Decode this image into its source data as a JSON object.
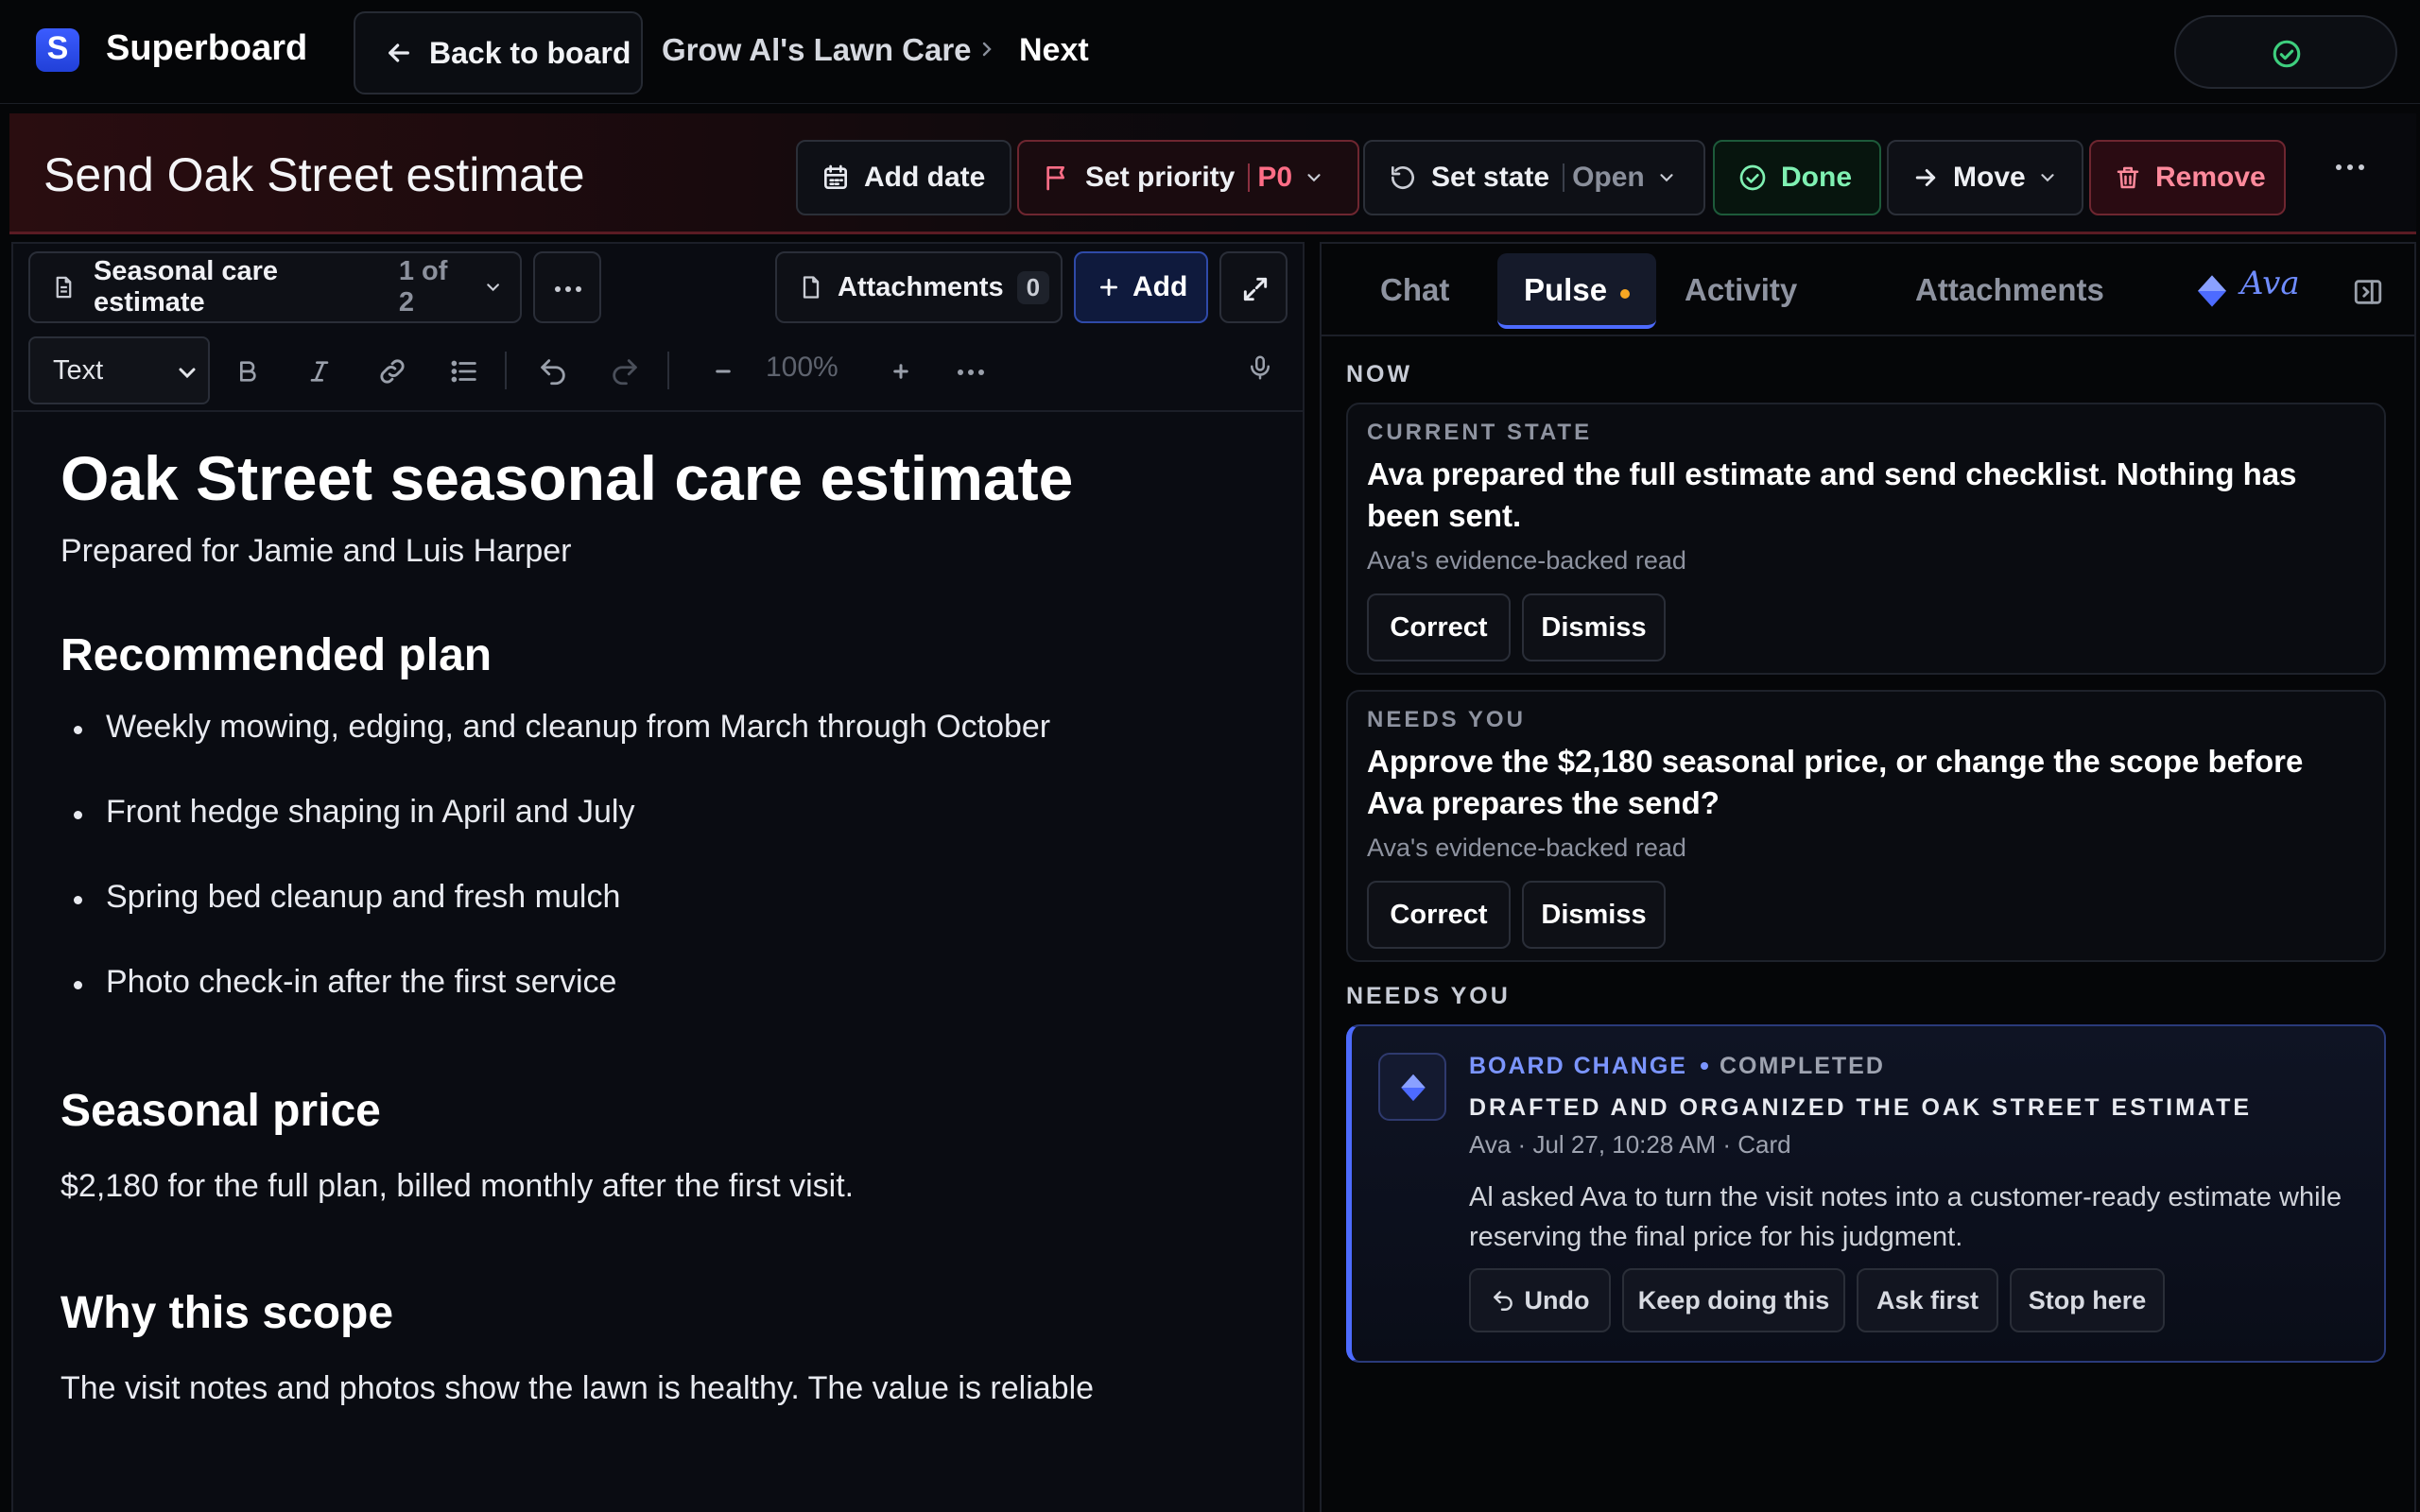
{
  "app": {
    "brand": "Superboard",
    "logo_letter": "S"
  },
  "nav": {
    "back_label": "Back to board",
    "breadcrumb": [
      "Grow Al's Lawn Care",
      "Next"
    ]
  },
  "card": {
    "title": "Send Oak Street estimate",
    "actions": {
      "add_date": "Add date",
      "set_priority": "Set priority",
      "priority_value": "P0",
      "set_state": "Set state",
      "state_value": "Open",
      "done": "Done",
      "move": "Move",
      "remove": "Remove"
    }
  },
  "editor": {
    "doc_name": "Seasonal care estimate",
    "doc_count": "1 of 2",
    "attachments_label": "Attachments",
    "attachments_count": "0",
    "add_label": "Add",
    "text_style": "Text",
    "zoom": "100%"
  },
  "document": {
    "title": "Oak Street seasonal care estimate",
    "prepared_for": "Prepared for Jamie and Luis Harper",
    "plan_heading": "Recommended plan",
    "plan_items": [
      "Weekly mowing, edging, and cleanup from March through October",
      "Front hedge shaping in April and July",
      "Spring bed cleanup and fresh mulch",
      "Photo check-in after the first service"
    ],
    "price_heading": "Seasonal price",
    "price_text": "$2,180 for the full plan, billed monthly after the first visit.",
    "scope_heading": "Why this scope",
    "scope_text": "The visit notes and photos show the lawn is healthy. The value is reliable"
  },
  "panel": {
    "tabs": [
      "Chat",
      "Pulse",
      "Activity",
      "Attachments"
    ],
    "active_tab": "Pulse",
    "ava_signature": "Ava",
    "now_label": "NOW",
    "current_state": {
      "kicker": "CURRENT STATE",
      "text": "Ava prepared the full estimate and send checklist. Nothing has been sent.",
      "note": "Ava's evidence-backed read",
      "correct": "Correct",
      "dismiss": "Dismiss"
    },
    "needs_you_card": {
      "kicker": "NEEDS YOU",
      "text": "Approve the $2,180 seasonal price, or change the scope before Ava prepares the send?",
      "note": "Ava's evidence-backed read",
      "correct": "Correct",
      "dismiss": "Dismiss"
    },
    "needs_you_label": "NEEDS YOU",
    "board_change": {
      "type": "BOARD CHANGE",
      "status": "COMPLETED",
      "title": "DRAFTED AND ORGANIZED THE OAK STREET ESTIMATE",
      "meta": "Ava · Jul 27, 10:28 AM · Card",
      "description": "Al asked Ava to turn the visit notes into a customer-ready estimate while reserving the final price for his judgment.",
      "undo": "Undo",
      "keep": "Keep doing this",
      "ask": "Ask first",
      "stop": "Stop here"
    }
  },
  "colors": {
    "accent": "#4d6bff",
    "danger": "#ff6d86",
    "success": "#7ff0b2",
    "pulse_dot": "#f5a623"
  }
}
